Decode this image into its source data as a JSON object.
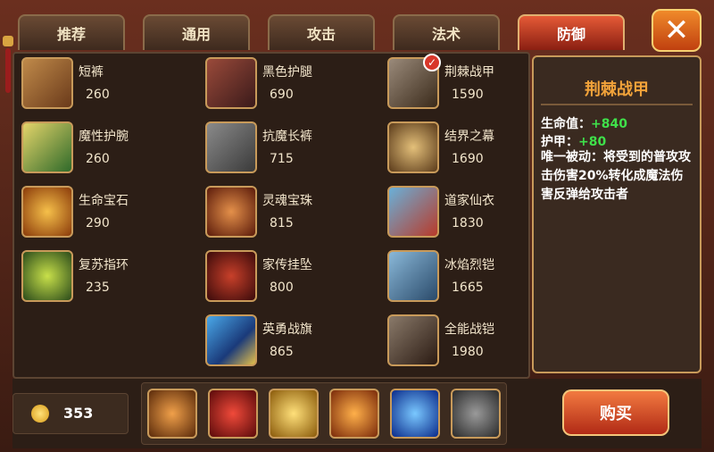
{
  "tabs": [
    {
      "label": "推荐",
      "active": false
    },
    {
      "label": "通用",
      "active": false
    },
    {
      "label": "攻击",
      "active": false
    },
    {
      "label": "法术",
      "active": false
    },
    {
      "label": "防御",
      "active": true
    }
  ],
  "close_icon": "close-x-icon",
  "items": [
    {
      "name": "短裤",
      "price": "260",
      "icon": "shorts-icon",
      "color": "#8a5a2e"
    },
    {
      "name": "魔性护腕",
      "price": "260",
      "icon": "bracer-icon",
      "color": "#3a6a2a"
    },
    {
      "name": "生命宝石",
      "price": "290",
      "icon": "life-gem-icon",
      "color": "#b8731a"
    },
    {
      "name": "复苏指环",
      "price": "235",
      "icon": "revival-ring-icon",
      "color": "#5f8a1f"
    },
    {
      "name": "黑色护腿",
      "price": "690",
      "icon": "black-greaves-icon",
      "color": "#7a2a22"
    },
    {
      "name": "抗魔长裤",
      "price": "715",
      "icon": "magic-resist-pants-icon",
      "color": "#5a5a5a"
    },
    {
      "name": "灵魂宝珠",
      "price": "815",
      "icon": "soul-orb-icon",
      "color": "#8a3a1a"
    },
    {
      "name": "家传挂坠",
      "price": "800",
      "icon": "heirloom-pendant-icon",
      "color": "#7a1f22"
    },
    {
      "name": "英勇战旗",
      "price": "865",
      "icon": "war-banner-icon",
      "color": "#2a6aa8"
    },
    {
      "name": "荆棘战甲",
      "price": "1590",
      "icon": "thorn-armor-icon",
      "color": "#5a4a3a",
      "selected": true
    },
    {
      "name": "结界之幕",
      "price": "1690",
      "icon": "barrier-veil-icon",
      "color": "#7a5a2a"
    },
    {
      "name": "道家仙衣",
      "price": "1830",
      "icon": "taoist-robe-icon",
      "color": "#3a6a8a"
    },
    {
      "name": "冰焰烈铠",
      "price": "1665",
      "icon": "ice-flame-armor-icon",
      "color": "#3a5a7a"
    },
    {
      "name": "全能战铠",
      "price": "1980",
      "icon": "omni-armor-icon",
      "color": "#5a3a2a"
    }
  ],
  "detail": {
    "title": "荆棘战甲",
    "stats": [
      {
        "label": "生命值：",
        "value": "+840"
      },
      {
        "label": "护甲：",
        "value": "+80"
      }
    ],
    "description": "唯一被动：将受到的普攻攻击伤害20%转化成魔法伤害反弹给攻击者"
  },
  "gold": {
    "value": "353",
    "icon": "gold-coin-icon"
  },
  "bag_slots": [
    {
      "icon": "shackle-icon",
      "color": "#b86a1a"
    },
    {
      "icon": "crimson-mask-icon",
      "color": "#b8201a"
    },
    {
      "icon": "golden-ring-icon",
      "color": "#c89a1a"
    },
    {
      "icon": "fire-staff-icon",
      "color": "#c85a1a"
    },
    {
      "icon": "blue-wave-icon",
      "color": "#1a4ac8"
    },
    {
      "icon": "steel-armor-icon",
      "color": "#4a4a4a"
    }
  ],
  "buy_label": "购买"
}
